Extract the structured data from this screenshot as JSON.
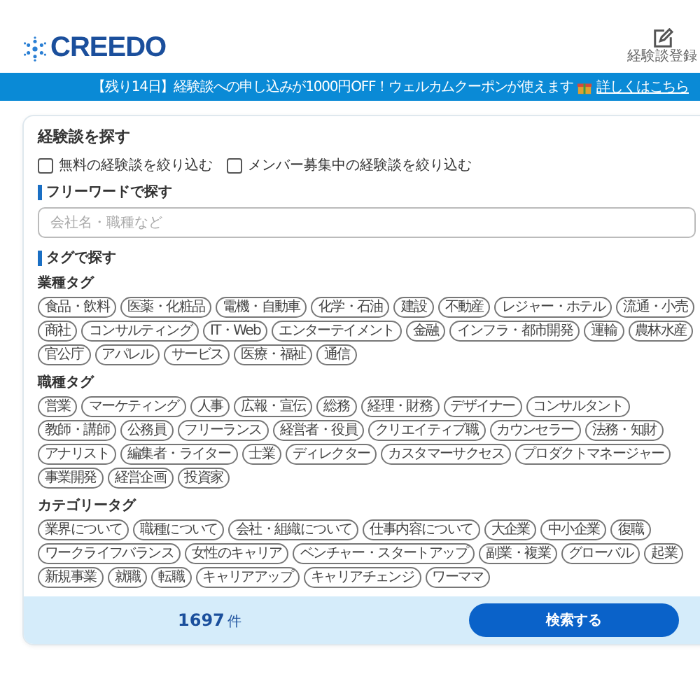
{
  "header": {
    "logo": "CREEDO",
    "post_label": "経験談登録"
  },
  "banner": {
    "text": "【残り14日】経験談への申し込みが1000円OFF！ウェルカムクーポンが使えます",
    "link": "詳しくはこちら"
  },
  "search": {
    "title": "経験談を探す",
    "filters": [
      {
        "label": "無料の経験談を絞り込む",
        "checked": false
      },
      {
        "label": "メンバー募集中の経験談を絞り込む",
        "checked": false
      }
    ],
    "freeword": {
      "heading": "フリーワードで探す",
      "placeholder": "会社名・職種など"
    },
    "tag_heading": "タグで探す",
    "tag_groups": [
      {
        "title": "業種タグ",
        "tags": [
          "食品・飲料",
          "医薬・化粧品",
          "電機・自動車",
          "化学・石油",
          "建設",
          "不動産",
          "レジャー・ホテル",
          "流通・小売",
          "商社",
          "コンサルティング",
          "IT・Web",
          "エンターテイメント",
          "金融",
          "インフラ・都市開発",
          "運輸",
          "農林水産",
          "官公庁",
          "アパレル",
          "サービス",
          "医療・福祉",
          "通信"
        ]
      },
      {
        "title": "職種タグ",
        "tags": [
          "営業",
          "マーケティング",
          "人事",
          "広報・宣伝",
          "総務",
          "経理・財務",
          "デザイナー",
          "コンサルタント",
          "教師・講師",
          "公務員",
          "フリーランス",
          "経営者・役員",
          "クリエイティブ職",
          "カウンセラー",
          "法務・知財",
          "アナリスト",
          "編集者・ライター",
          "士業",
          "ディレクター",
          "カスタマーサクセス",
          "プロダクトマネージャー",
          "事業開発",
          "経営企画",
          "投資家"
        ]
      },
      {
        "title": "カテゴリータグ",
        "tags": [
          "業界について",
          "職種について",
          "会社・組織について",
          "仕事内容について",
          "大企業",
          "中小企業",
          "復職",
          "ワークライフバランス",
          "女性のキャリア",
          "ベンチャー・スタートアップ",
          "副業・複業",
          "グローバル",
          "起業",
          "新規事業",
          "就職",
          "転職",
          "キャリアアップ",
          "キャリアチェンジ",
          "ワーママ"
        ]
      }
    ],
    "count": "1697",
    "count_unit": "件",
    "submit": "検索する"
  }
}
